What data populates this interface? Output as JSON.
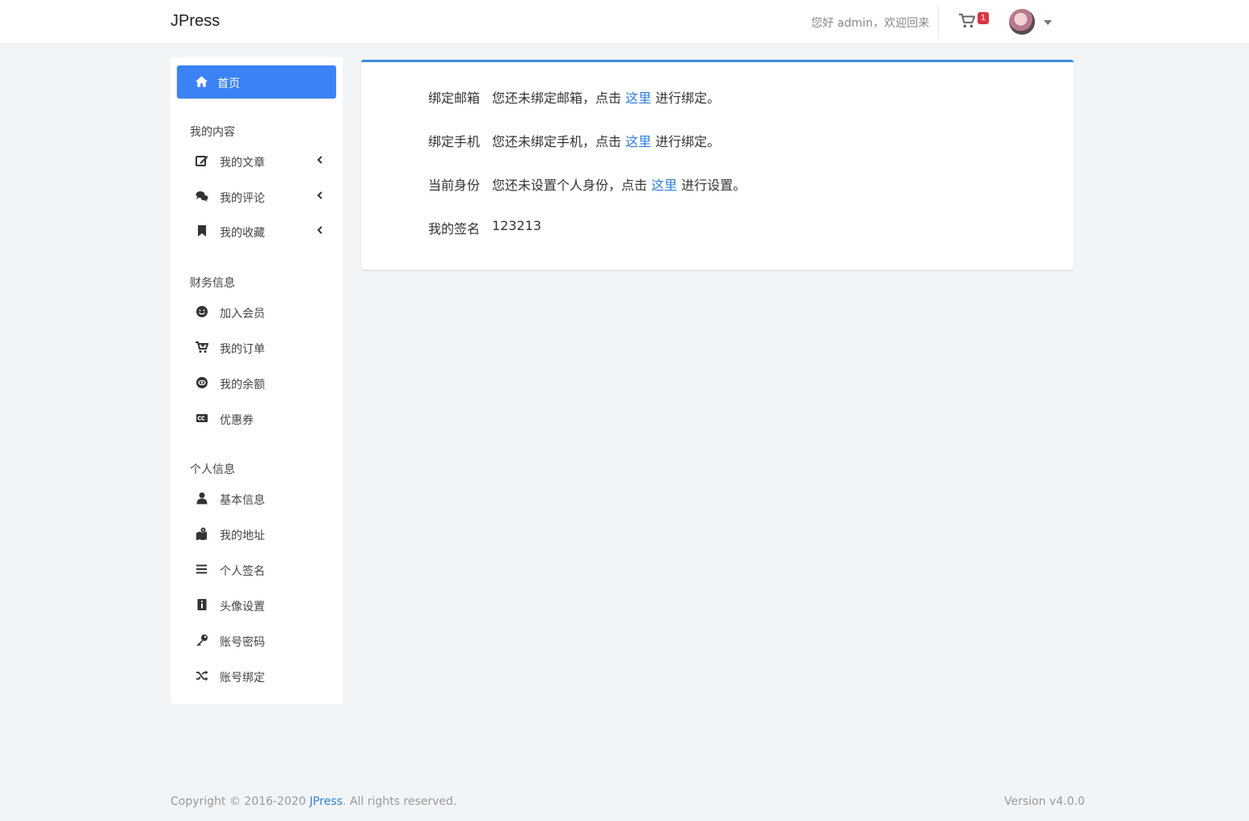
{
  "header": {
    "brand": "JPress",
    "greeting": "您好 admin，欢迎回来",
    "cart_count": "1"
  },
  "sidebar": {
    "home": "首页",
    "sections": [
      {
        "title": "我的内容",
        "items": [
          "我的文章",
          "我的评论",
          "我的收藏"
        ]
      },
      {
        "title": "财务信息",
        "items": [
          "加入会员",
          "我的订单",
          "我的余额",
          "优惠券"
        ]
      },
      {
        "title": "个人信息",
        "items": [
          "基本信息",
          "我的地址",
          "个人签名",
          "头像设置",
          "账号密码",
          "账号绑定"
        ]
      }
    ]
  },
  "main": {
    "rows": [
      {
        "label": "绑定邮箱",
        "before": "您还未绑定邮箱，点击",
        "link": "这里",
        "after": "进行绑定。"
      },
      {
        "label": "绑定手机",
        "before": "您还未绑定手机，点击",
        "link": "这里",
        "after": "进行绑定。"
      },
      {
        "label": "当前身份",
        "before": "您还未设置个人身份，点击",
        "link": "这里",
        "after": "进行设置。"
      },
      {
        "label": "我的签名",
        "value": "123213"
      }
    ]
  },
  "footer": {
    "copyright_prefix": "Copyright © 2016-2020",
    "brand_link": "JPress",
    "copyright_suffix": ". All rights reserved.",
    "version": "Version v4.0.0"
  },
  "colors": {
    "accent": "#3b82f6",
    "link": "#2f7fd8",
    "badge": "#dc3545",
    "background": "#f2f5f8"
  }
}
